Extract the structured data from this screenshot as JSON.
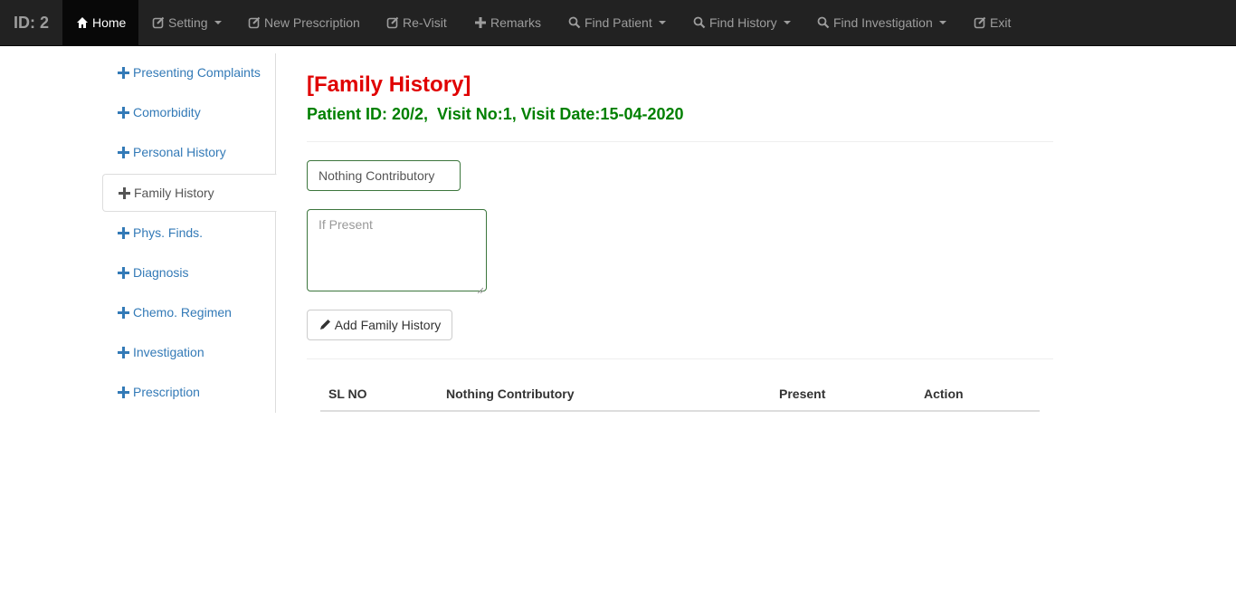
{
  "navbar": {
    "brand": "ID: 2",
    "items": [
      {
        "label": "Home",
        "icon": "home-icon"
      },
      {
        "label": "Setting",
        "icon": "edit-icon",
        "dropdown": true
      },
      {
        "label": "New Prescription",
        "icon": "edit-icon"
      },
      {
        "label": "Re-Visit",
        "icon": "edit-icon"
      },
      {
        "label": "Remarks",
        "icon": "plus-icon"
      },
      {
        "label": "Find Patient",
        "icon": "search-icon",
        "dropdown": true
      },
      {
        "label": "Find History",
        "icon": "search-icon",
        "dropdown": true
      },
      {
        "label": "Find Investigation",
        "icon": "search-icon",
        "dropdown": true
      },
      {
        "label": "Exit",
        "icon": "edit-icon"
      }
    ]
  },
  "sidebar": {
    "items": [
      {
        "label": "Presenting Complaints"
      },
      {
        "label": "Comorbidity"
      },
      {
        "label": "Personal History"
      },
      {
        "label": "Family History"
      },
      {
        "label": "Phys. Finds."
      },
      {
        "label": "Diagnosis"
      },
      {
        "label": "Chemo. Regimen"
      },
      {
        "label": "Investigation"
      },
      {
        "label": "Prescription"
      }
    ]
  },
  "main": {
    "title": "[Family History]",
    "subtitle": "Patient ID: 20/2,  Visit No:1, Visit Date:15-04-2020",
    "select_value": "Nothing Contributory",
    "textarea_placeholder": "If Present",
    "add_button": "Add Family History"
  },
  "table": {
    "columns": [
      "SL NO",
      "Nothing Contributory",
      "Present",
      "Action"
    ]
  },
  "colors": {
    "navbar_bg": "#222222",
    "title": "#e00000",
    "subtitle": "#008000",
    "link": "#337ab7"
  }
}
